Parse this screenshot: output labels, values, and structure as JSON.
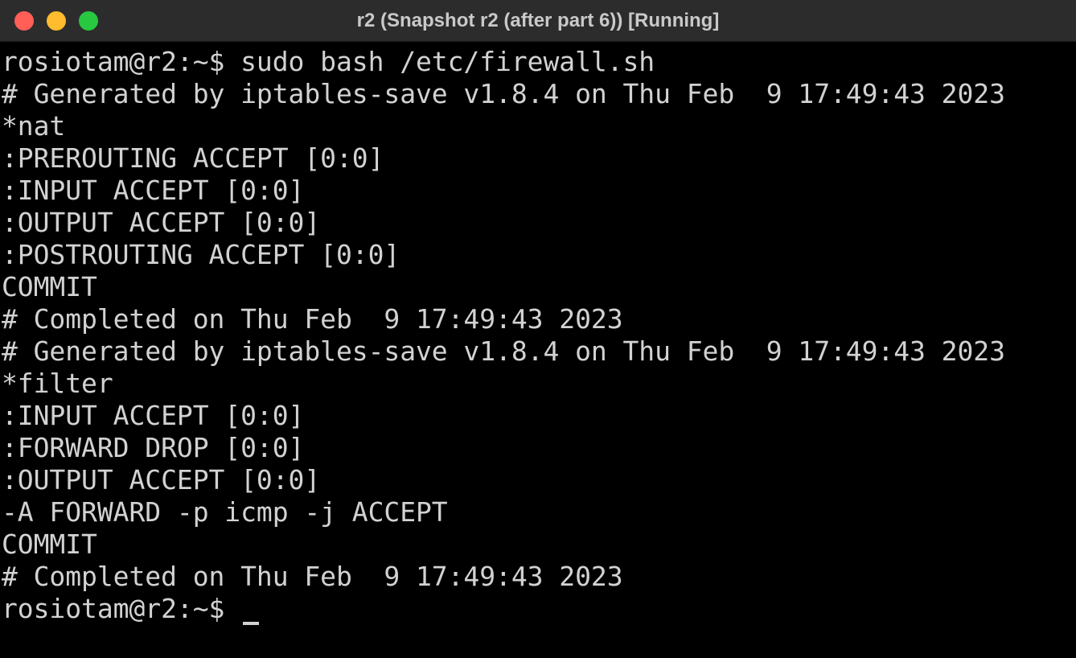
{
  "window": {
    "title": "r2 (Snapshot r2 (after part 6)) [Running]"
  },
  "terminal": {
    "lines": [
      "rosiotam@r2:~$ sudo bash /etc/firewall.sh",
      "# Generated by iptables-save v1.8.4 on Thu Feb  9 17:49:43 2023",
      "*nat",
      ":PREROUTING ACCEPT [0:0]",
      ":INPUT ACCEPT [0:0]",
      ":OUTPUT ACCEPT [0:0]",
      ":POSTROUTING ACCEPT [0:0]",
      "COMMIT",
      "# Completed on Thu Feb  9 17:49:43 2023",
      "# Generated by iptables-save v1.8.4 on Thu Feb  9 17:49:43 2023",
      "*filter",
      ":INPUT ACCEPT [0:0]",
      ":FORWARD DROP [0:0]",
      ":OUTPUT ACCEPT [0:0]",
      "-A FORWARD -p icmp -j ACCEPT",
      "COMMIT",
      "# Completed on Thu Feb  9 17:49:43 2023",
      "rosiotam@r2:~$ "
    ]
  }
}
